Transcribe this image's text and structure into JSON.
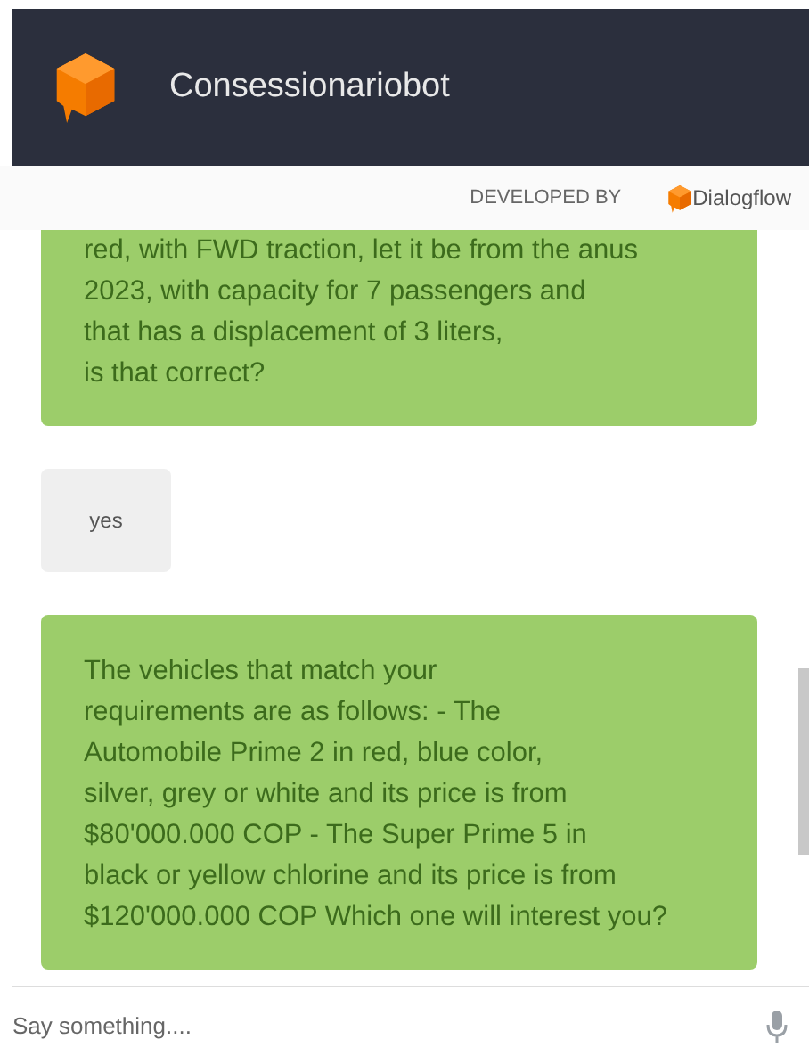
{
  "header": {
    "title": "Consessionariobot"
  },
  "credit": {
    "label": "DEVELOPED BY",
    "brand": "Dialogflow"
  },
  "messages": [
    {
      "kind": "bot",
      "cut": true,
      "text": "red, with FWD traction, let it be from the anus\n 2023, with capacity for 7 passengers and\nthat has a displacement of 3 liters,\nis that correct?"
    },
    {
      "kind": "user",
      "text": "yes"
    },
    {
      "kind": "bot",
      "cut": false,
      "text": "The vehicles that match your\nrequirements are as follows: - The\nAutomobile Prime 2 in red, blue color,\nsilver, grey or white and its price is from\n$80'000.000 COP - The Super Prime 5 in\nblack or yellow chlorine and its price is from\n$120'000.000 COP Which one will interest you?"
    }
  ],
  "input": {
    "placeholder": "Say something...."
  }
}
